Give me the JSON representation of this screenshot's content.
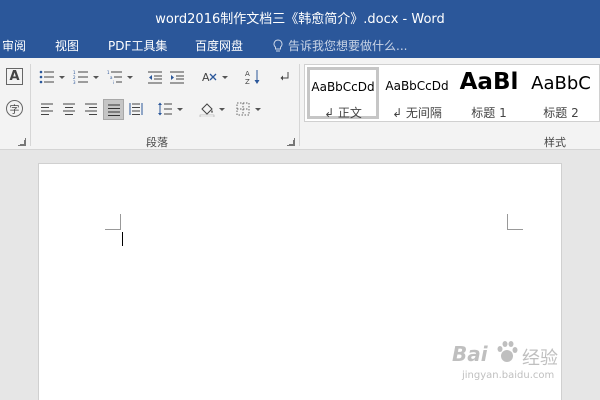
{
  "window": {
    "title": "word2016制作文档三《韩愈简介》.docx - Word"
  },
  "tabs": [
    {
      "label": "审阅"
    },
    {
      "label": "视图"
    },
    {
      "label": "PDF工具集"
    },
    {
      "label": "百度网盘"
    }
  ],
  "tell_me": {
    "placeholder": "告诉我您想要做什么..."
  },
  "ribbon": {
    "font_group": {
      "char_border_glyph": "A",
      "phonetic_glyph": "字"
    },
    "paragraph_group": {
      "label": "段落"
    },
    "styles_group": {
      "label": "样式",
      "items": [
        {
          "sample": "AaBbCcDd",
          "name": "↲ 正文",
          "selected": true
        },
        {
          "sample": "AaBbCcDd",
          "name": "↲ 无间隔",
          "selected": false
        },
        {
          "sample": "AaBl",
          "name": "标题 1",
          "selected": false
        },
        {
          "sample": "AaBbC",
          "name": "标题 2",
          "selected": false
        }
      ]
    }
  },
  "watermark": {
    "brand": "Bai",
    "brand2": "经验",
    "url": "jingyan.baidu.com"
  },
  "colors": {
    "accent": "#2b579a",
    "ribbon_bg": "#f3f3f3",
    "canvas_bg": "#e6e6e6"
  }
}
